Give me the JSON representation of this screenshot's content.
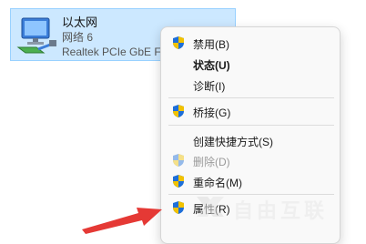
{
  "adapter": {
    "name": "以太网",
    "network": "网络 6",
    "device": "Realtek PCIe GbE Family Controller",
    "icon": "network-adapter-icon"
  },
  "menu": {
    "items": [
      {
        "label": "禁用(B)",
        "icon": "uac-shield-icon"
      },
      {
        "label": "状态(U)"
      },
      {
        "label": "诊断(I)"
      },
      {
        "label": "桥接(G)",
        "icon": "uac-shield-icon"
      },
      {
        "label": "创建快捷方式(S)"
      },
      {
        "label": "删除(D)",
        "icon": "uac-shield-icon"
      },
      {
        "label": "重命名(M)",
        "icon": "uac-shield-icon"
      },
      {
        "label": "属性(R)",
        "icon": "uac-shield-icon"
      }
    ]
  },
  "watermark": {
    "text": "自由互联"
  },
  "colors": {
    "selection": "#cce8ff",
    "arrow": "#e53935",
    "shield_blue": "#1e6fd9",
    "shield_yellow": "#f2c200"
  }
}
